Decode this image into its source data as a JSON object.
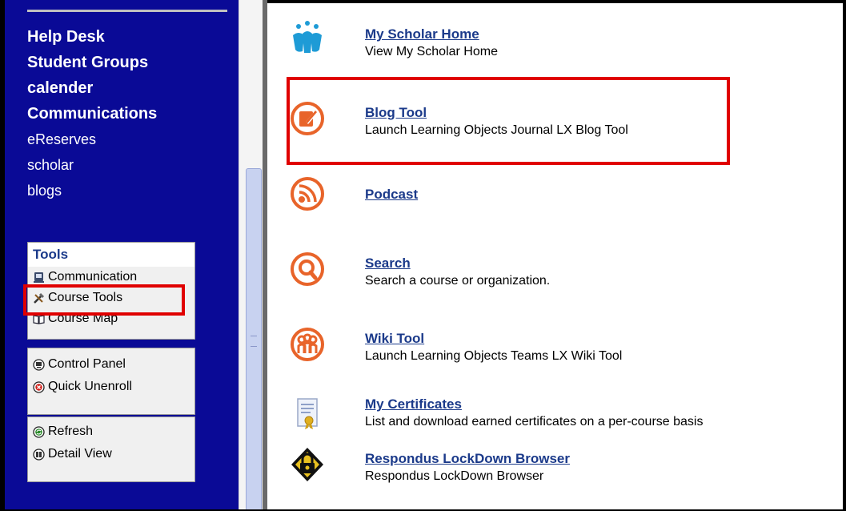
{
  "sidebar": {
    "course_links": [
      {
        "label": "Help Desk",
        "bold": true
      },
      {
        "label": "Student Groups",
        "bold": true
      },
      {
        "label": "calender",
        "bold": true
      },
      {
        "label": "Communications",
        "bold": true
      },
      {
        "label": "eReserves",
        "bold": false
      },
      {
        "label": "scholar",
        "bold": false
      },
      {
        "label": "blogs",
        "bold": false
      }
    ],
    "tools_panel": {
      "header": "Tools",
      "items": [
        "Communication",
        "Course Tools",
        "Course Map"
      ]
    },
    "control_panel": {
      "items": [
        "Control Panel",
        "Quick Unenroll"
      ]
    },
    "view_panel": {
      "items": [
        "Refresh",
        "Detail View"
      ]
    }
  },
  "tools": [
    {
      "title": "My Scholar Home",
      "description": "View My Scholar Home",
      "icon": "scholar-people-icon"
    },
    {
      "title": "Blog Tool",
      "description": "Launch Learning Objects Journal LX Blog Tool",
      "icon": "blog-icon"
    },
    {
      "title": "Podcast",
      "description": "",
      "icon": "podcast-icon"
    },
    {
      "title": "Search",
      "description": "Search a course or organization.",
      "icon": "search-icon"
    },
    {
      "title": "Wiki Tool",
      "description": "Launch Learning Objects Teams LX Wiki Tool",
      "icon": "wiki-icon"
    },
    {
      "title": "My Certificates",
      "description": "List and download earned certificates on a per-course basis",
      "icon": "certificate-icon"
    },
    {
      "title": "Respondus LockDown Browser",
      "description": "Respondus LockDown Browser",
      "icon": "lock-icon"
    }
  ],
  "colors": {
    "sidebar_bg": "#0a0a96",
    "link": "#1b3a8a",
    "highlight": "#e00000",
    "tool_orange": "#e8642a"
  }
}
